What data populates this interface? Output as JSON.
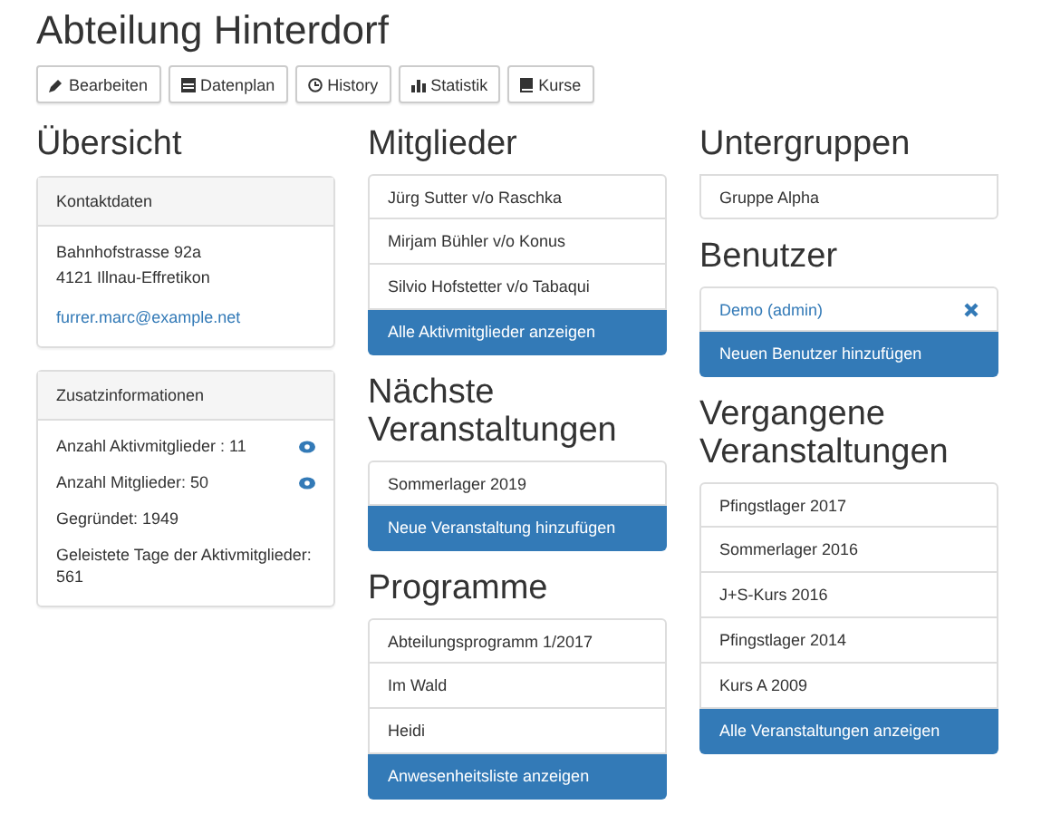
{
  "title": "Abteilung Hinterdorf",
  "toolbar": [
    {
      "label": "Bearbeiten",
      "kind": "pencil"
    },
    {
      "label": "Datenplan",
      "kind": "calendar"
    },
    {
      "label": "History",
      "kind": "clock"
    },
    {
      "label": "Statistik",
      "kind": "chart"
    },
    {
      "label": "Kurse",
      "kind": "book"
    }
  ],
  "columns": [
    [
      {
        "kind": "panels",
        "heading": "Übersicht",
        "panels": [
          {
            "title": "Kontaktdaten",
            "lines": [
              {
                "text": "Bahnhofstrasse 92a",
                "kind": "text",
                "eye": false
              },
              {
                "text": "4121 Illnau-Effretikon",
                "kind": "text",
                "eye": false
              },
              {
                "text": "furrer.marc@example.net",
                "kind": "link",
                "eye": false
              }
            ]
          },
          {
            "title": "Zusatzinformationen",
            "lines": [
              {
                "text": "Anzahl Aktivmitglieder : 11",
                "kind": "text",
                "eye": true
              },
              {
                "text": "Anzahl Mitglieder: 50",
                "kind": "text",
                "eye": true
              },
              {
                "text": "Gegründet: 1949",
                "kind": "text",
                "eye": false
              },
              {
                "text": "Geleistete Tage der Aktivmitglieder: 561",
                "kind": "text",
                "eye": false
              }
            ]
          }
        ]
      }
    ],
    [
      {
        "kind": "list",
        "heading": "Mitglieder",
        "items": [
          {
            "text": "Jürg Sutter v/o Raschka",
            "kind": "item"
          },
          {
            "text": "Mirjam Bühler v/o Konus",
            "kind": "item"
          },
          {
            "text": "Silvio Hofstetter v/o Tabaqui",
            "kind": "item"
          },
          {
            "text": "Alle Aktivmitglieder anzeigen",
            "kind": "action"
          }
        ]
      },
      {
        "kind": "list",
        "heading": "Nächste Veranstaltungen",
        "items": [
          {
            "text": "Sommerlager 2019",
            "kind": "item"
          },
          {
            "text": "Neue Veranstaltung hinzufügen",
            "kind": "action"
          }
        ]
      },
      {
        "kind": "list",
        "heading": "Programme",
        "items": [
          {
            "text": "Abteilungsprogramm 1/2017",
            "kind": "item"
          },
          {
            "text": "Im Wald",
            "kind": "item"
          },
          {
            "text": "Heidi",
            "kind": "item"
          },
          {
            "text": "Anwesenheitsliste anzeigen",
            "kind": "action"
          }
        ]
      }
    ],
    [
      {
        "kind": "list",
        "heading": "Untergruppen",
        "items": [
          {
            "text": "Gruppe Alpha",
            "kind": "item"
          }
        ]
      },
      {
        "kind": "list",
        "heading": "Benutzer",
        "items": [
          {
            "text": "Demo (admin)",
            "kind": "removable"
          },
          {
            "text": "Neuen Benutzer hinzufügen",
            "kind": "action"
          }
        ]
      },
      {
        "kind": "list",
        "heading": "Vergangene Veranstaltungen",
        "items": [
          {
            "text": "Pfingstlager 2017",
            "kind": "item"
          },
          {
            "text": "Sommerlager 2016",
            "kind": "item"
          },
          {
            "text": "J+S-Kurs 2016",
            "kind": "item"
          },
          {
            "text": "Pfingstlager 2014",
            "kind": "item"
          },
          {
            "text": "Kurs A 2009",
            "kind": "item"
          },
          {
            "text": "Alle Veranstaltungen anzeigen",
            "kind": "action"
          }
        ]
      }
    ]
  ]
}
